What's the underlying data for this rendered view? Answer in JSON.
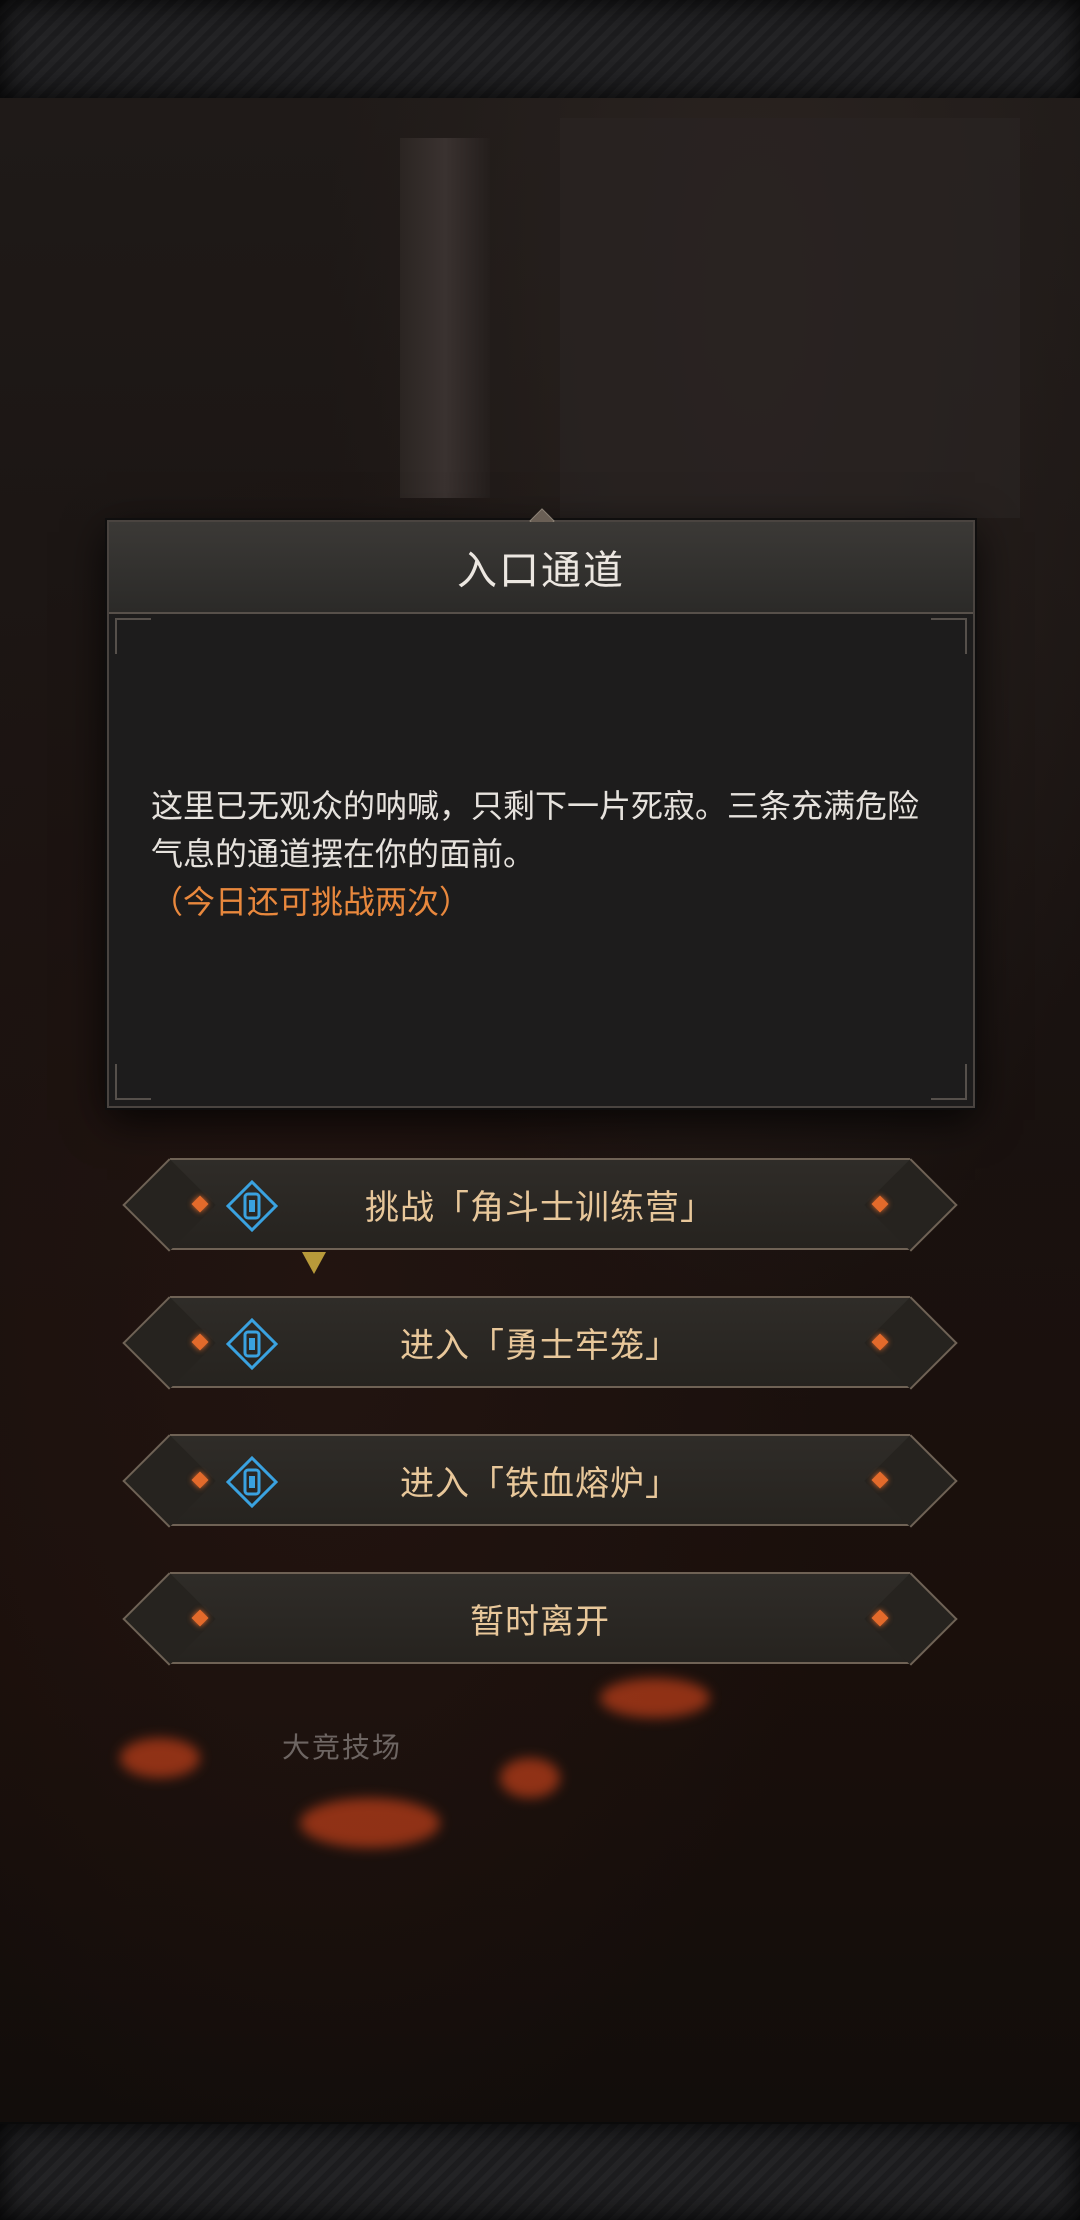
{
  "dialog": {
    "title": "入口通道",
    "body": "这里已无观众的呐喊，只剩下一片死寂。三条充满危险气息的通道摆在你的面前。",
    "remaining": "（今日还可挑战两次）"
  },
  "options": [
    {
      "label": "挑战「角斗士训练营」",
      "icon": "key-icon"
    },
    {
      "label": "进入「勇士牢笼」",
      "icon": "key-icon"
    },
    {
      "label": "进入「铁血熔炉」",
      "icon": "key-icon"
    },
    {
      "label": "暂时离开",
      "icon": ""
    }
  ],
  "scene": {
    "location_label": "大竞技场"
  },
  "colors": {
    "accent_orange": "#e9883d",
    "option_text": "#e8c79a",
    "key_icon_blue": "#3aa2e0"
  }
}
